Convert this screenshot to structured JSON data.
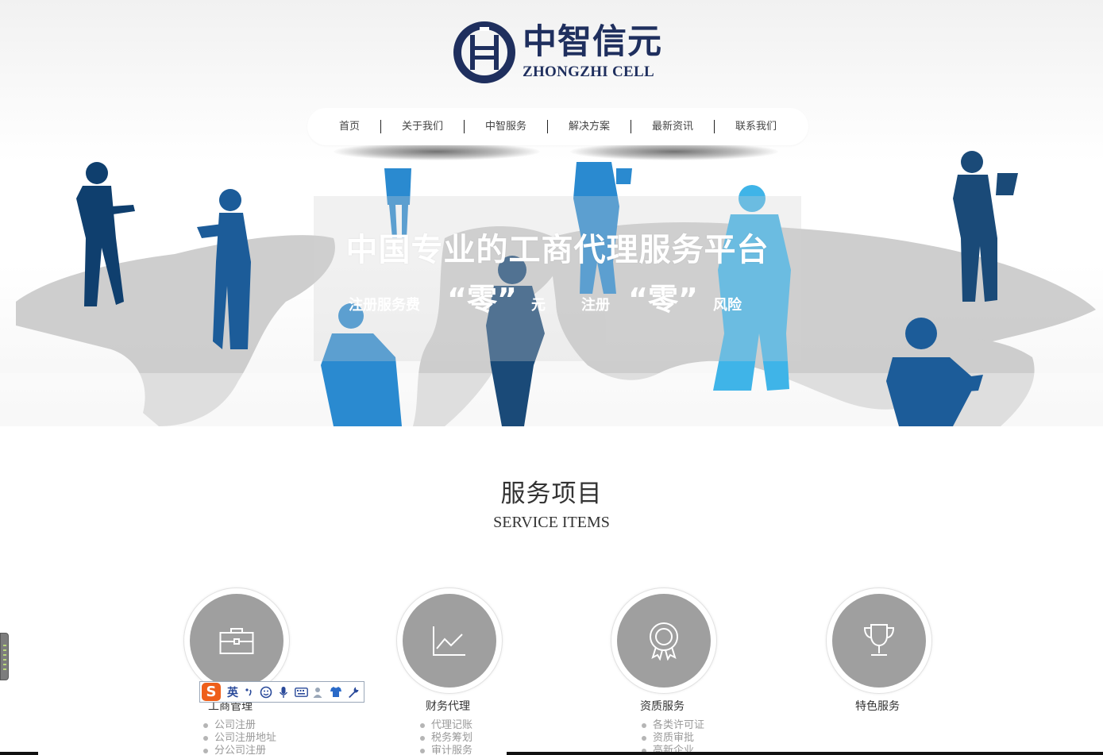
{
  "brand": {
    "name_cn": "中智信元",
    "name_en": "ZHONGZHI CELL",
    "primary_color": "#1f2f5e"
  },
  "nav": {
    "items": [
      {
        "label": "首页"
      },
      {
        "label": "关于我们"
      },
      {
        "label": "中智服务"
      },
      {
        "label": "解决方案"
      },
      {
        "label": "最新资讯"
      },
      {
        "label": "联系我们"
      }
    ]
  },
  "banner": {
    "title": "中国专业的工商代理服务平台",
    "sub_1": "注册服务费",
    "sub_2": "“零”",
    "sub_3": "元",
    "sub_4": "注册",
    "sub_5": "“零”",
    "sub_6": "风险",
    "silhouette_colors": [
      "#0f3f6e",
      "#1c5c99",
      "#2a8ad0",
      "#3fb4e8"
    ]
  },
  "services": {
    "title": "服务项目",
    "subtitle": "SERVICE ITEMS",
    "items": [
      {
        "icon": "briefcase-icon",
        "name": "工商管理",
        "list": [
          "公司注册",
          "公司注册地址",
          "分公司注册"
        ]
      },
      {
        "icon": "chart-icon",
        "name": "财务代理",
        "list": [
          "代理记账",
          "税务筹划",
          "审计服务"
        ]
      },
      {
        "icon": "award-icon",
        "name": "资质服务",
        "list": [
          "各类许可证",
          "资质审批",
          "高新企业"
        ]
      },
      {
        "icon": "trophy-icon",
        "name": "特色服务",
        "list": []
      }
    ]
  },
  "ime": {
    "logo": "S",
    "lang": "英"
  }
}
